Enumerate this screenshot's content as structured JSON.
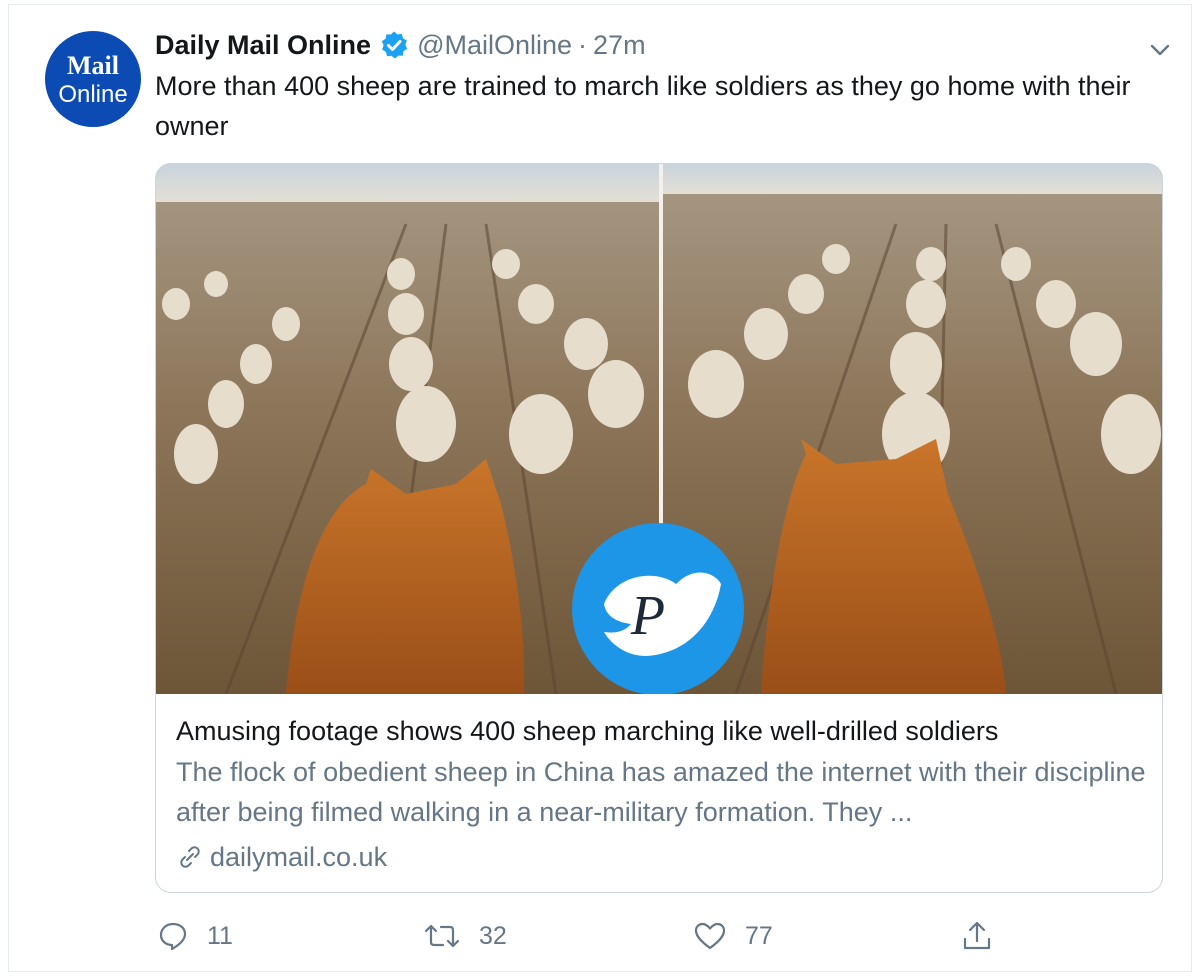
{
  "account": {
    "avatar_line1": "Mail",
    "avatar_line2": "Online",
    "name": "Daily Mail Online",
    "handle": "@MailOnline",
    "separator": "·",
    "time": "27m"
  },
  "tweet": {
    "text": "More than 400 sheep are trained to march like soldiers as they go home with their owner"
  },
  "card": {
    "title": "Amusing footage shows 400 sheep marching like well-drilled soldiers",
    "description": "The flock of obedient sheep in China has amazed the internet with their discipline after being filmed walking in a near-military formation. They ...",
    "domain": "dailymail.co.uk",
    "watermark_letter": "P"
  },
  "actions": {
    "replies": "11",
    "retweets": "32",
    "likes": "77"
  },
  "icons": [
    "verified-badge-icon",
    "chevron-down-icon",
    "link-icon",
    "reply-icon",
    "retweet-icon",
    "like-icon",
    "share-icon"
  ],
  "colors": {
    "verified": "#1da1f2",
    "avatar_bg": "#0b4bb3",
    "muted_text": "#657786",
    "watermark": "#1e96e8"
  }
}
